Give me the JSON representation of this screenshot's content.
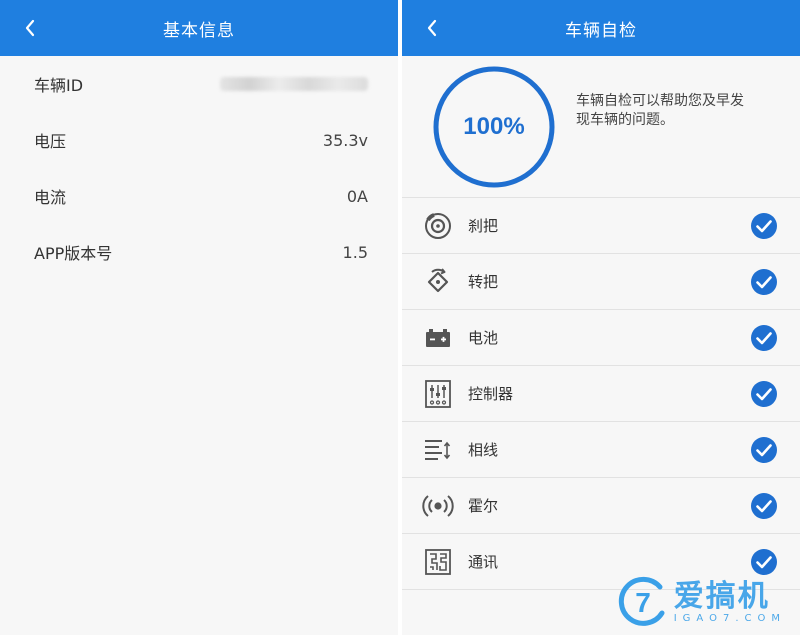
{
  "left": {
    "title": "基本信息",
    "rows": [
      {
        "label": "车辆ID",
        "value": ""
      },
      {
        "label": "电压",
        "value": "35.3v"
      },
      {
        "label": "电流",
        "value": "0A"
      },
      {
        "label": "APP版本号",
        "value": "1.5"
      }
    ]
  },
  "right": {
    "title": "车辆自检",
    "progress_text": "100%",
    "progress": 1.0,
    "description": "车辆自检可以帮助您及早发现车辆的问题。",
    "items": [
      {
        "label": "刹把",
        "icon": "brake-icon",
        "checked": true
      },
      {
        "label": "转把",
        "icon": "throttle-icon",
        "checked": true
      },
      {
        "label": "电池",
        "icon": "battery-icon",
        "checked": true
      },
      {
        "label": "控制器",
        "icon": "controller-icon",
        "checked": true
      },
      {
        "label": "相线",
        "icon": "phase-wire-icon",
        "checked": true
      },
      {
        "label": "霍尔",
        "icon": "hall-sensor-icon",
        "checked": true
      },
      {
        "label": "通讯",
        "icon": "communication-icon",
        "checked": true
      }
    ]
  },
  "watermark": {
    "text": "爱搞机",
    "sub": "IGAO7.COM",
    "logo_char": "7"
  },
  "colors": {
    "primary": "#1f7fe0",
    "ring": "#1f6fd0",
    "check": "#1f6fd0",
    "background": "#f7f7f7"
  }
}
